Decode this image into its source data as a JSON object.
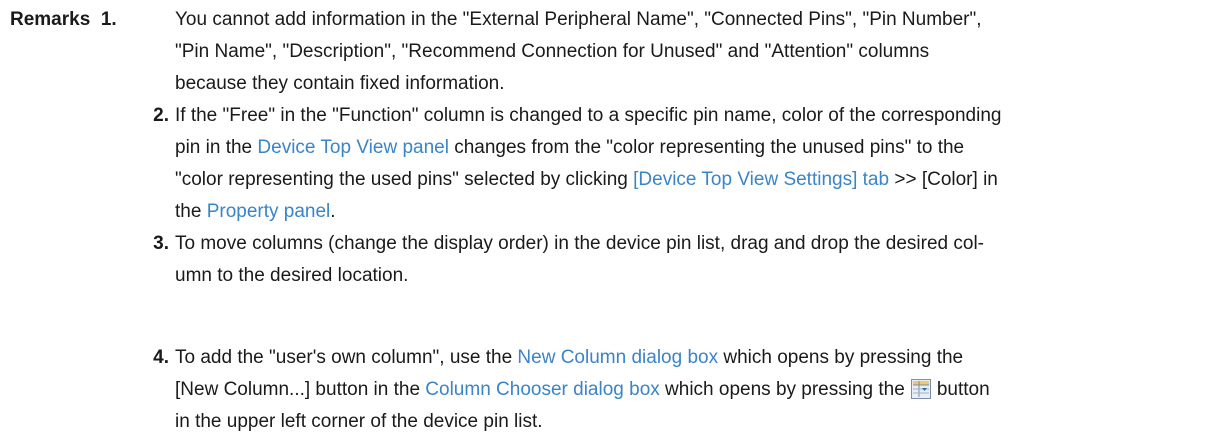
{
  "heading": "Remarks",
  "items": [
    {
      "num": "1.",
      "lines": [
        "You cannot add information in the \"External Peripheral Name\", \"Connected Pins\", \"Pin Number\",",
        "\"Pin Name\", \"Description\", \"Recommend Connection for Unused\" and \"Attention\" columns",
        "because they contain fixed information."
      ]
    },
    {
      "num": "2.",
      "l1": "If the \"Free\" in the \"Function\" column is changed to a specific pin name, color of the corresponding",
      "l2_pre": "pin in the ",
      "l2_link": "Device Top View panel",
      "l2_post": " changes from the \"color representing the unused pins\" to the",
      "l3_pre": "\"color representing the used pins\" selected by clicking ",
      "l3_link": "[Device Top View Settings] tab",
      "l3_post": " >> [Color] in",
      "l4_pre": "the ",
      "l4_link": "Property panel",
      "l4_post": "."
    },
    {
      "num": "3.",
      "lines": [
        "To move columns (change the display order) in the device pin list, drag and drop the desired col-",
        "umn to the desired location."
      ]
    },
    {
      "num": "4.",
      "l1_pre": "To add the \"user's own column\", use the ",
      "l1_link": "New Column dialog box",
      "l1_post": " which opens by pressing the",
      "l2_pre": "[New Column...] button in the ",
      "l2_link": "Column Chooser dialog box",
      "l2_post": " which opens by pressing the",
      "l2_icon": "column-chooser-icon",
      "l2_end": "button",
      "l3": "in the upper left corner of the device pin list."
    }
  ],
  "colors": {
    "link": "#3a84c9",
    "text": "#1a1a1a"
  }
}
